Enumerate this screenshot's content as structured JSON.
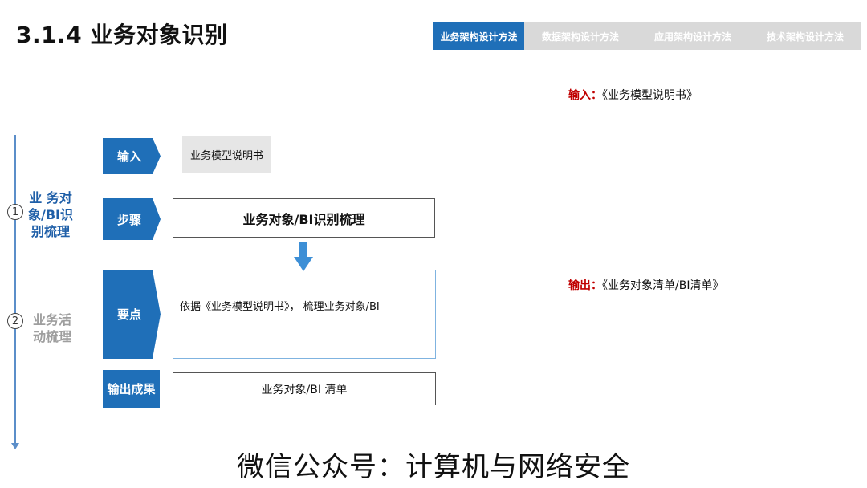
{
  "title": "3.1.4 业务对象识别",
  "tabs": [
    {
      "label": "业务架构设计方法",
      "active": true
    },
    {
      "label": "数据架构设计方法",
      "active": false
    },
    {
      "label": "应用架构设计方法",
      "active": false
    },
    {
      "label": "技术架构设计方法",
      "active": false
    }
  ],
  "notes": {
    "input_label": "输入：",
    "input_value": "《业务模型说明书》",
    "output_label": "输出：",
    "output_value": "《业务对象清单/BI清单》"
  },
  "timeline": {
    "phases": [
      {
        "number": "1",
        "lines": [
          "业 务对",
          "象/BI识",
          "别梳理"
        ]
      },
      {
        "number": "2",
        "lines": [
          "业务活",
          "动梳理"
        ]
      }
    ]
  },
  "flow": {
    "input_tag": "输入",
    "input_value": "业务模型说明书",
    "step_tag": "步骤",
    "step_value": "业务对象/BI识别梳理",
    "key_tag": "要点",
    "key_value": "依据《业务模型说明书》，  梳理业务对象/BI",
    "result_tag": "输出成果",
    "result_value": "业务对象/BI 清单"
  },
  "footer": "微信公众号：计算机与网络安全",
  "colors": {
    "accent": "#1f6fb8",
    "note_label": "#c00000",
    "timeline": "#5b8ec9",
    "phase_active": "#1f5fa8",
    "phase_inactive": "#9e9e9e"
  }
}
